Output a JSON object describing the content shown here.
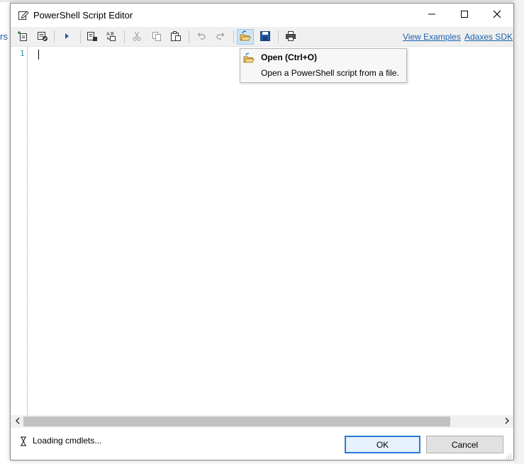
{
  "background": {
    "fragment_text": "rs"
  },
  "window": {
    "title": "PowerShell Script Editor",
    "title_icon": "edit-document-icon",
    "controls": [
      "minimize-icon",
      "maximize-icon",
      "close-icon"
    ]
  },
  "toolbar": {
    "buttons": [
      "new-line-icon",
      "validate-icon",
      "run-icon",
      "insert-snippet-icon",
      "replace-icon",
      "cut-icon",
      "copy-icon",
      "paste-icon",
      "undo-icon",
      "redo-icon",
      "open-file-icon",
      "save-icon",
      "print-icon"
    ],
    "links": {
      "view_examples": "View Examples",
      "adaxes_sdk": "Adaxes SDK"
    }
  },
  "editor": {
    "line_numbers": [
      "1"
    ],
    "content": ""
  },
  "tooltip": {
    "title": "Open (Ctrl+O)",
    "description": "Open a PowerShell script from a file."
  },
  "status": {
    "text": "Loading cmdlets..."
  },
  "buttons": {
    "ok": "OK",
    "cancel": "Cancel"
  },
  "colors": {
    "accent": "#2b7bd6",
    "link": "#1a64ad",
    "line_number": "#2b91af",
    "toolbar_bg": "#f0f0f0"
  }
}
